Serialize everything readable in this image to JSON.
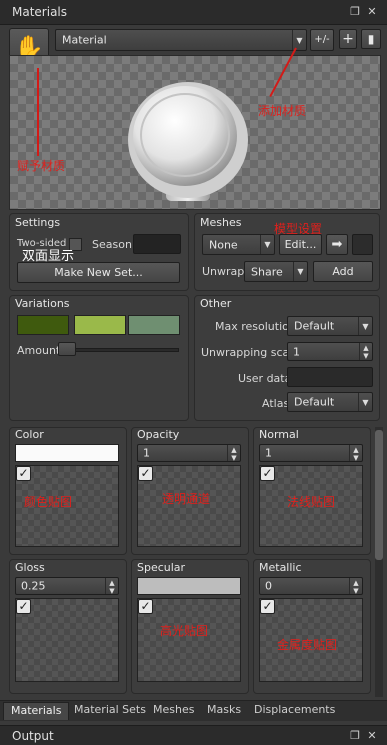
{
  "title": "Materials",
  "material_select": "Material",
  "plus_minus_label": "+/-",
  "settings": {
    "title": "Settings",
    "two_sided": "Two-sided",
    "two_sided_cn": "双面显示",
    "season": "Season",
    "make_new_set": "Make New Set..."
  },
  "meshes": {
    "title": "Meshes",
    "mesh_select": "None",
    "edit": "Edit...",
    "unwrap": "Unwrap",
    "unwrap_value": "Share",
    "add": "Add",
    "annotation": "模型设置"
  },
  "variations": {
    "title": "Variations",
    "amount": "Amount",
    "swatches": [
      "#3f5a0e",
      "#9ab94a",
      "#6f8f71"
    ]
  },
  "other": {
    "title": "Other",
    "max_resolution_label": "Max resolution",
    "max_resolution_value": "Default",
    "unwrapping_scale_label": "Unwrapping scale",
    "unwrapping_scale_value": "1",
    "user_data_label": "User data",
    "atlas_label": "Atlas",
    "atlas_value": "Default"
  },
  "annotations": {
    "assign_material": "赋予材质",
    "add_material": "添加材质"
  },
  "channels": [
    {
      "name": "Color",
      "value": "",
      "note": "颜色贴图"
    },
    {
      "name": "Opacity",
      "value": "1",
      "note": "透明通道"
    },
    {
      "name": "Normal",
      "value": "1",
      "note": "法线贴图"
    },
    {
      "name": "Gloss",
      "value": "0.25",
      "note": ""
    },
    {
      "name": "Specular",
      "value": "",
      "note": "高光贴图"
    },
    {
      "name": "Metallic",
      "value": "0",
      "note": "金属度贴图"
    }
  ],
  "tabs": [
    "Materials",
    "Material Sets",
    "Meshes",
    "Masks",
    "Displacements"
  ],
  "output_title": "Output"
}
